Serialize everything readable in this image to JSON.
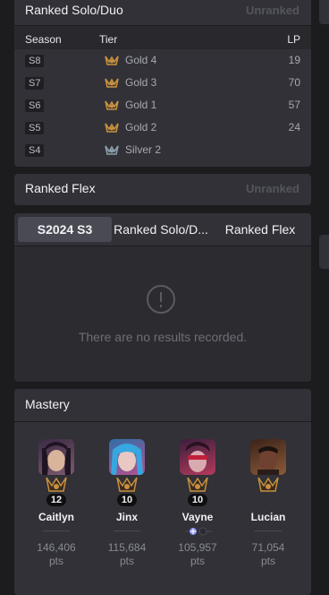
{
  "ranked_solo": {
    "title": "Ranked Solo/Duo",
    "status": "Unranked",
    "headers": {
      "season": "Season",
      "tier": "Tier",
      "lp": "LP"
    },
    "rows": [
      {
        "season": "S8",
        "tier": "Gold 4",
        "lp": "19",
        "tier_color": "#c8913e"
      },
      {
        "season": "S7",
        "tier": "Gold 3",
        "lp": "70",
        "tier_color": "#c8913e"
      },
      {
        "season": "S6",
        "tier": "Gold 1",
        "lp": "57",
        "tier_color": "#c8913e"
      },
      {
        "season": "S5",
        "tier": "Gold 2",
        "lp": "24",
        "tier_color": "#c8913e"
      },
      {
        "season": "S4",
        "tier": "Silver 2",
        "lp": "",
        "tier_color": "#8aa0aa"
      }
    ]
  },
  "ranked_flex": {
    "title": "Ranked Flex",
    "status": "Unranked"
  },
  "tabs": {
    "items": [
      "S2024 S3",
      "Ranked Solo/D...",
      "Ranked Flex"
    ],
    "active": 0,
    "empty_message": "There are no results recorded."
  },
  "mastery": {
    "title": "Mastery",
    "champions": [
      {
        "name": "Caitlyn",
        "level": "12",
        "points": "146,406",
        "unit": "pts",
        "portrait_colors": [
          "#3b2a45",
          "#7d5a6e"
        ]
      },
      {
        "name": "Jinx",
        "level": "10",
        "points": "115,684",
        "unit": "pts",
        "portrait_colors": [
          "#2f6fa8",
          "#b64f8e"
        ]
      },
      {
        "name": "Vayne",
        "level": "10",
        "points": "105,957",
        "unit": "pts",
        "portrait_colors": [
          "#3a1f3d",
          "#b53a5c"
        ]
      },
      {
        "name": "Lucian",
        "level": "",
        "points": "71,054",
        "unit": "pts",
        "portrait_colors": [
          "#3a2318",
          "#8d5a3a"
        ]
      }
    ]
  },
  "colors": {
    "background": "#1c1c1f",
    "card": "#313137",
    "gold": "#c8913e",
    "silver": "#8aa0aa",
    "muted": "#55555e"
  }
}
